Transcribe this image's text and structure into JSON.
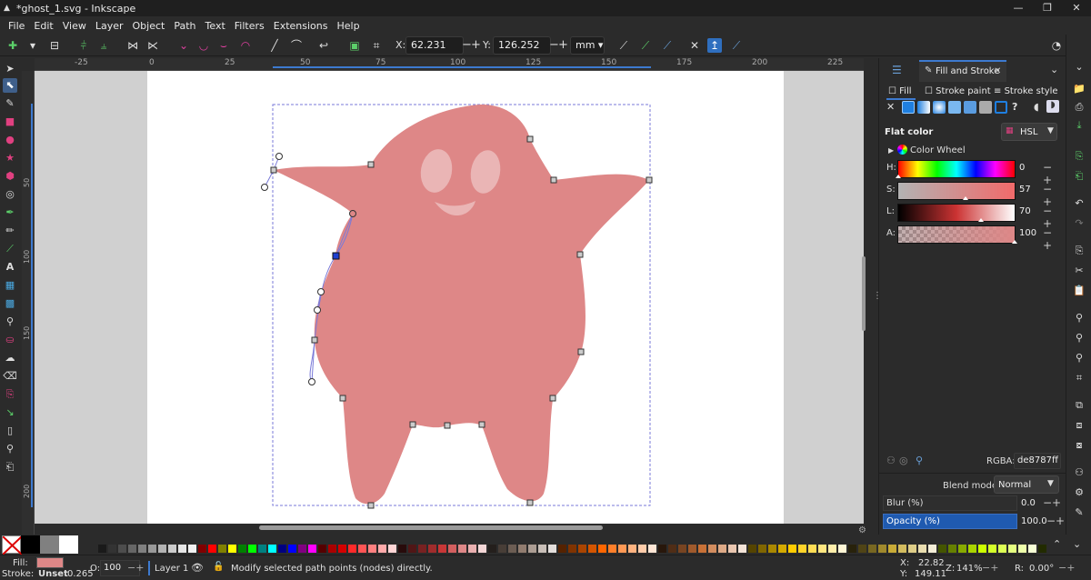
{
  "window": {
    "title": "*ghost_1.svg - Inkscape",
    "controls": [
      "minimize-icon",
      "restore-icon",
      "close-icon"
    ]
  },
  "menu": [
    "File",
    "Edit",
    "View",
    "Layer",
    "Object",
    "Path",
    "Text",
    "Filters",
    "Extensions",
    "Help"
  ],
  "tool_controls": {
    "x_label": "X:",
    "x_value": "62.231",
    "y_label": "Y:",
    "y_value": "126.252",
    "unit": "mm"
  },
  "ruler": {
    "top_labels": [
      "-25",
      "0",
      "25",
      "50",
      "75",
      "100",
      "125",
      "150",
      "175",
      "200",
      "225"
    ],
    "left_labels": [
      "50",
      "100",
      "150",
      "200"
    ]
  },
  "panel": {
    "tab_label": "Fill and Stroke",
    "subtabs": {
      "fill": "Fill",
      "stroke_paint": "Stroke paint",
      "stroke_style": "Stroke style"
    },
    "flat_color_label": "Flat color",
    "color_mode": "HSL",
    "color_wheel_label": "Color Wheel",
    "sliders": [
      {
        "label": "H:",
        "value": "0"
      },
      {
        "label": "S:",
        "value": "57"
      },
      {
        "label": "L:",
        "value": "70"
      },
      {
        "label": "A:",
        "value": "100"
      }
    ],
    "rgba_label": "RGBA:",
    "rgba_value": "de8787ff",
    "blend_mode_label": "Blend mode:",
    "blend_mode_value": "Normal",
    "blur_label": "Blur (%)",
    "blur_value": "0.0",
    "opacity_label": "Opacity (%)",
    "opacity_value": "100.0"
  },
  "status": {
    "fill_label": "Fill:",
    "stroke_label": "Stroke:",
    "stroke_value": "Unset",
    "stroke_width": "0.265",
    "opacity_label": "O:",
    "opacity_value": "100",
    "layer": "Layer 1",
    "message": "Modify selected path points (nodes) directly.",
    "cursor_x_label": "X:",
    "cursor_x": "22.82",
    "cursor_y_label": "Y:",
    "cursor_y": "149.11",
    "zoom_label": "Z:",
    "zoom": "141%",
    "rotation_label": "R:",
    "rotation": "0.00°"
  },
  "colors": {
    "fill": "#de8787",
    "ui_bg": "#2b2b2b",
    "accent": "#2f6fbf"
  }
}
